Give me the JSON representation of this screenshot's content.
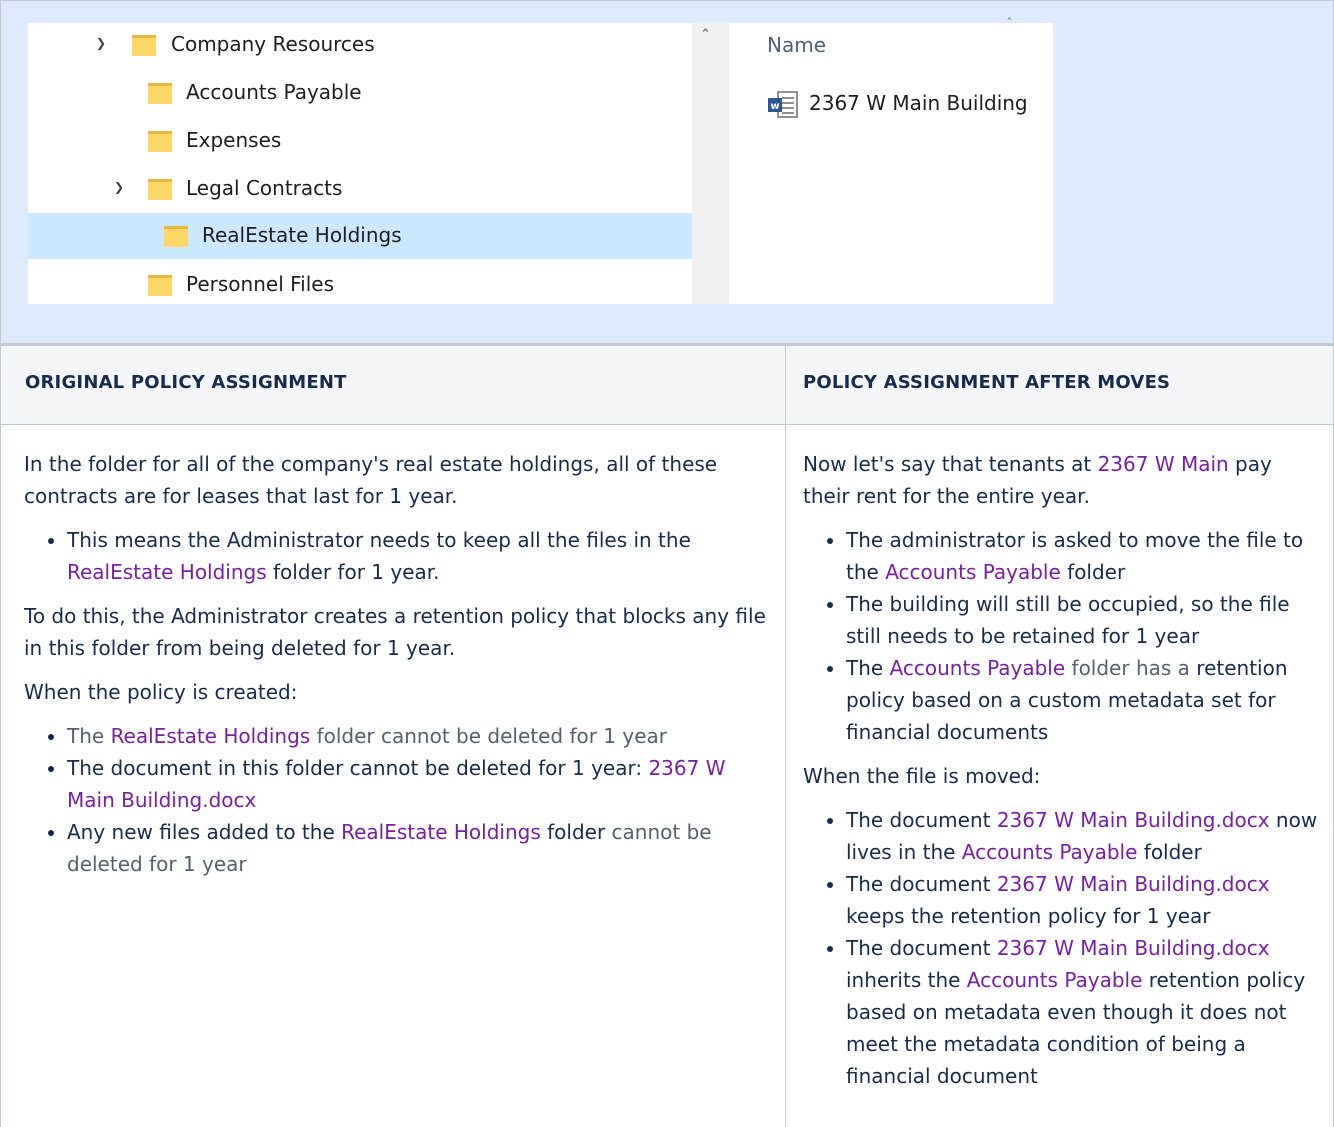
{
  "explorer": {
    "tree": [
      {
        "label": "Company Resources",
        "expanded": true,
        "selected": false
      },
      {
        "label": "Accounts Payable",
        "expanded": false,
        "selected": false
      },
      {
        "label": "Expenses",
        "expanded": false,
        "selected": false
      },
      {
        "label": "Legal Contracts",
        "expanded": true,
        "selected": false
      },
      {
        "label": "RealEstate Holdings",
        "expanded": false,
        "selected": true
      },
      {
        "label": "Personnel Files",
        "expanded": false,
        "selected": false
      }
    ],
    "files_header": "Name",
    "file_name": "2367 W Main Building",
    "icons": {
      "folder": "folder-icon",
      "word": "word-document-icon",
      "chevron": "chevron-down-icon",
      "scroll_up": "scroll-up-icon",
      "close": "close-icon"
    },
    "folder_color": "#ffd767",
    "selection_color": "#cce8ff"
  },
  "table": {
    "headers": {
      "left": "ORIGINAL POLICY ASSIGNMENT",
      "right": "POLICY ASSIGNMENT AFTER MOVES"
    },
    "left": {
      "p1": "In the folder for all of the company's real estate holdings, all of these contracts are for leases that last for 1 year.",
      "b1_pre": "This means the Administrator needs to keep all the files in the ",
      "b1_link": "RealEstate Holdings",
      "b1_post": " folder for 1 year.",
      "p2": "To do this, the Administrator creates a retention policy that blocks any file in this folder from being deleted for 1 year.",
      "p3": "When the policy is created:",
      "l1_pre": "The ",
      "l1_link": "RealEstate Holdings",
      "l1_post": " folder cannot be deleted for 1 year",
      "l2_pre": "The document in this folder cannot be deleted for 1 year: ",
      "l2_link": "2367 W Main Building.docx",
      "l3_pre": "Any new files added to the ",
      "l3_link": "RealEstate Holdings",
      "l3_mid": " folder ",
      "l3_post": "cannot be deleted for 1 year"
    },
    "right": {
      "p1_pre": "Now let's say that tenants at ",
      "p1_link": "2367 W Main",
      "p1_post": " pay their rent for the entire year.",
      "a1_pre": "The administrator is asked to move the file to the ",
      "a1_link": "Accounts Payable",
      "a1_post": " folder",
      "a2": "The building will still be occupied, so the file still needs to be retained for 1 year",
      "a3_pre": "The ",
      "a3_link": "Accounts Payable",
      "a3_mid": " folder has a",
      "a3_post": " retention policy based on a custom metadata set for financial documents",
      "p2": "When the file is moved:",
      "m1_pre": "The document ",
      "m1_link": "2367 W Main Building.docx",
      "m1_mid": " now lives in the ",
      "m1_link2": "Accounts Payable",
      "m1_post": " folder",
      "m2_pre": "The document ",
      "m2_link": "2367 W Main Building.docx",
      "m2_post": " keeps the retention policy for 1 year",
      "m3_pre": "The document ",
      "m3_link": "2367 W Main Building.docx",
      "m3_mid": " inherits the ",
      "m3_link2": "Accounts Payable",
      "m3_post": " retention policy based on metadata even though it does not meet the metadata condition of being a financial document"
    },
    "link_color": "#7a1ea1",
    "header_bg": "#f4f5f7",
    "band_bg": "#deebff"
  }
}
